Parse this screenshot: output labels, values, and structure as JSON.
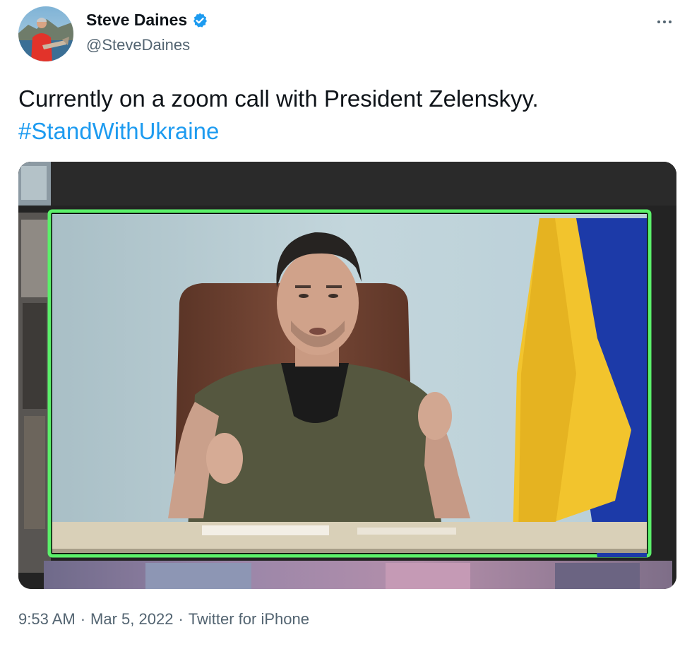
{
  "author": {
    "display_name": "Steve Daines",
    "handle": "@SteveDaines",
    "verified": true
  },
  "tweet": {
    "text": "Currently on a zoom call with President Zelenskyy.",
    "hashtag": "#StandWithUkraine",
    "time": "9:53 AM",
    "date": "Mar 5, 2022",
    "source": "Twitter for iPhone",
    "separator": "·"
  },
  "icons": {
    "verified": "verified-badge-icon",
    "more": "more-horizontal-icon"
  },
  "colors": {
    "link": "#1d9bf0",
    "secondary_text": "#536471",
    "primary_text": "#0f1419",
    "verified_badge": "#1d9bf0",
    "active_speaker_border": "#5bf06a"
  }
}
